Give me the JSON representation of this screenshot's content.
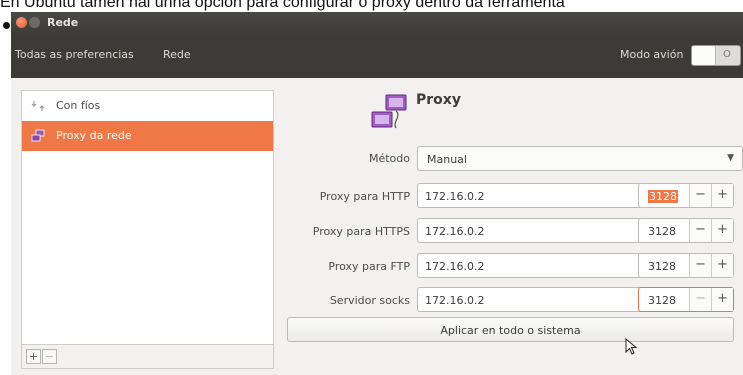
{
  "caption": "En Ubuntu tamén hai unha opción para configurar o proxy dentro da ferramenta",
  "window": {
    "title": "Rede"
  },
  "toolbar": {
    "breadcrumb_all": "Todas as preferencias",
    "breadcrumb_current": "Rede",
    "airplane_mode_label": "Modo avión",
    "airplane_toggle_state": "O"
  },
  "sidebar": {
    "items": [
      {
        "label": "Con fíos",
        "icon": "network-wired-icon"
      },
      {
        "label": "Proxy da rede",
        "icon": "proxy-icon",
        "selected": true
      }
    ],
    "add_label": "+",
    "remove_label": "−"
  },
  "panel": {
    "title": "Proxy",
    "method": {
      "label": "Método",
      "value": "Manual"
    },
    "rows": [
      {
        "label": "Proxy para HTTP",
        "host": "172.16.0.2",
        "port": "3128"
      },
      {
        "label": "Proxy para HTTPS",
        "host": "172.16.0.2",
        "port": "3128"
      },
      {
        "label": "Proxy para FTP",
        "host": "172.16.0.2",
        "port": "3128"
      },
      {
        "label": "Servidor socks",
        "host": "172.16.0.2",
        "port": "3128"
      }
    ],
    "stepper_minus": "−",
    "stepper_plus": "+",
    "apply_label": "Aplicar en todo o sistema"
  },
  "colors": {
    "accent": "#f07746",
    "titlebar": "#3c3b37",
    "background": "#f2f1f0"
  }
}
